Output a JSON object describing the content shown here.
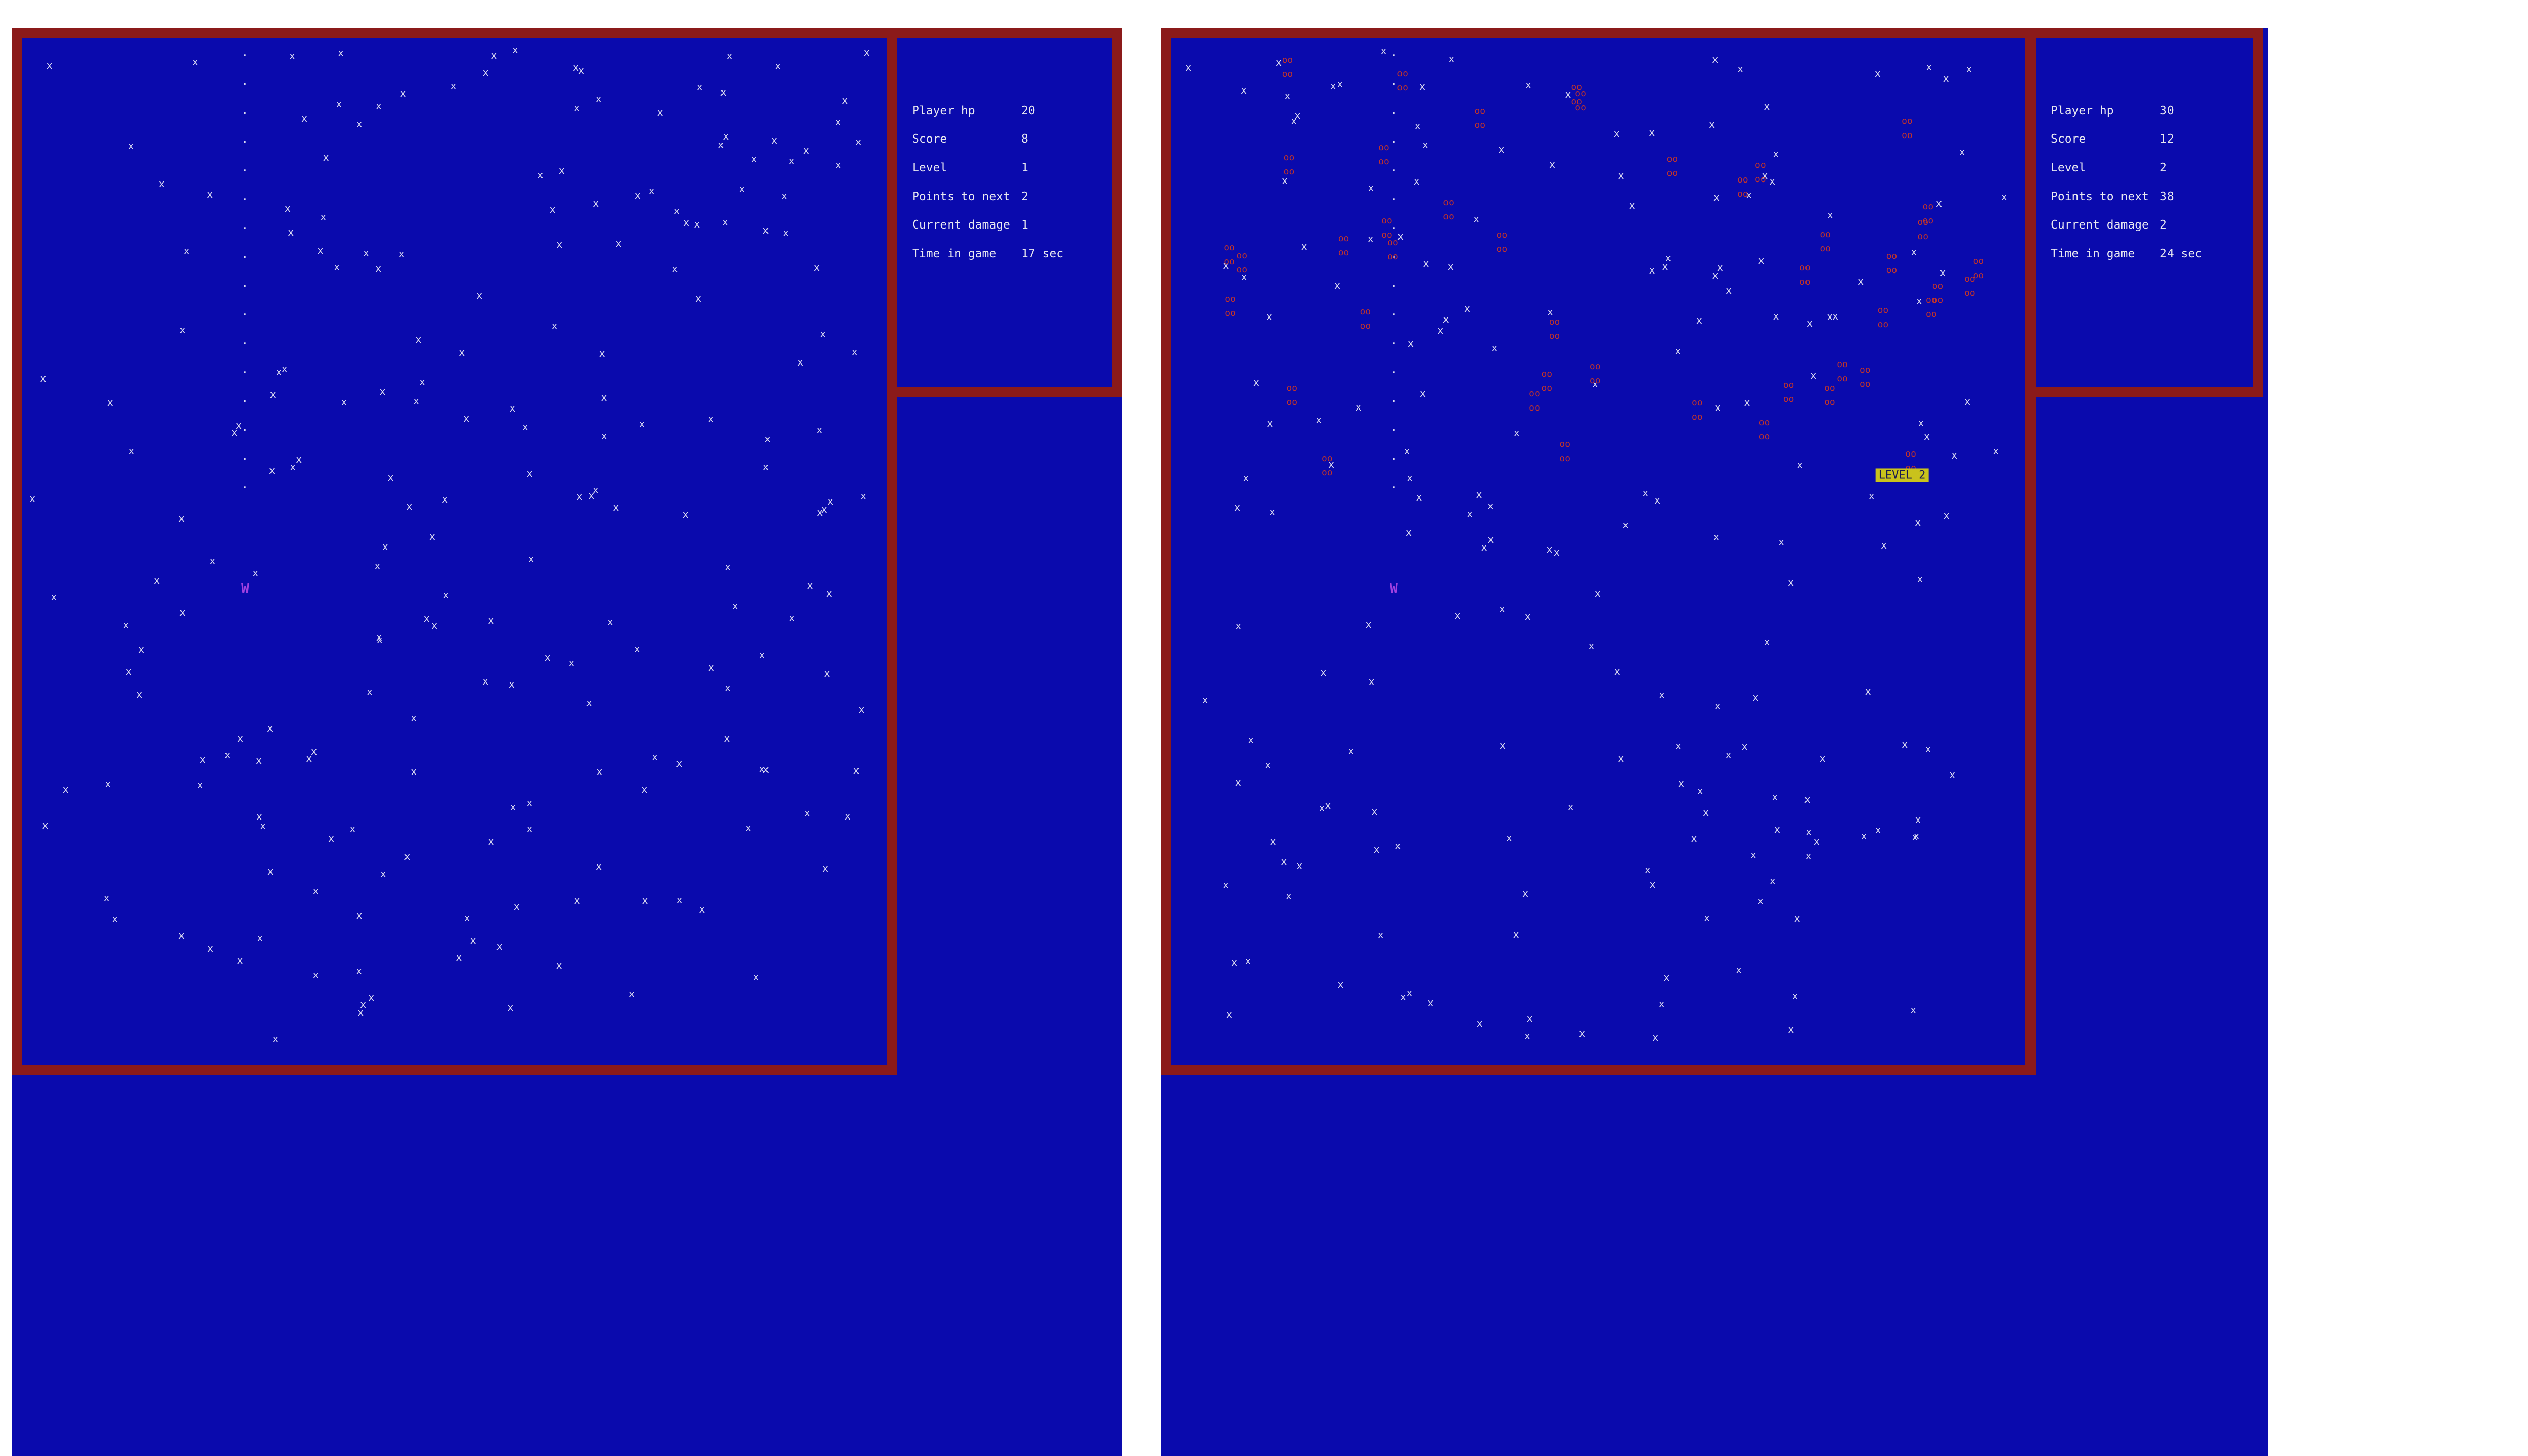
{
  "colors": {
    "background": "#0a0aad",
    "border": "#8b1a1a",
    "enemy": "#c2342a",
    "player": "#a040e0",
    "banner": "#c9c21c"
  },
  "glyphs": {
    "obstacle": "x",
    "pickup": ".",
    "enemy_row": "oo",
    "player": "W"
  },
  "screens": [
    {
      "stats": [
        {
          "label": "Player hp",
          "value": "20"
        },
        {
          "label": "Score",
          "value": "8"
        },
        {
          "label": "Level",
          "value": "1"
        },
        {
          "label": "Points to next",
          "value": "2"
        },
        {
          "label": "Current damage",
          "value": "1"
        },
        {
          "label": "Time in game",
          "value": "17 sec"
        }
      ],
      "banner": null,
      "player_glyph": "W"
    },
    {
      "stats": [
        {
          "label": "Player hp",
          "value": "30"
        },
        {
          "label": "Score",
          "value": "12"
        },
        {
          "label": "Level",
          "value": "2"
        },
        {
          "label": "Points to next",
          "value": "38"
        },
        {
          "label": "Current damage",
          "value": "2"
        },
        {
          "label": "Time in game",
          "value": "24 sec"
        }
      ],
      "banner": "LEVEL 2",
      "player_glyph": "W"
    }
  ]
}
